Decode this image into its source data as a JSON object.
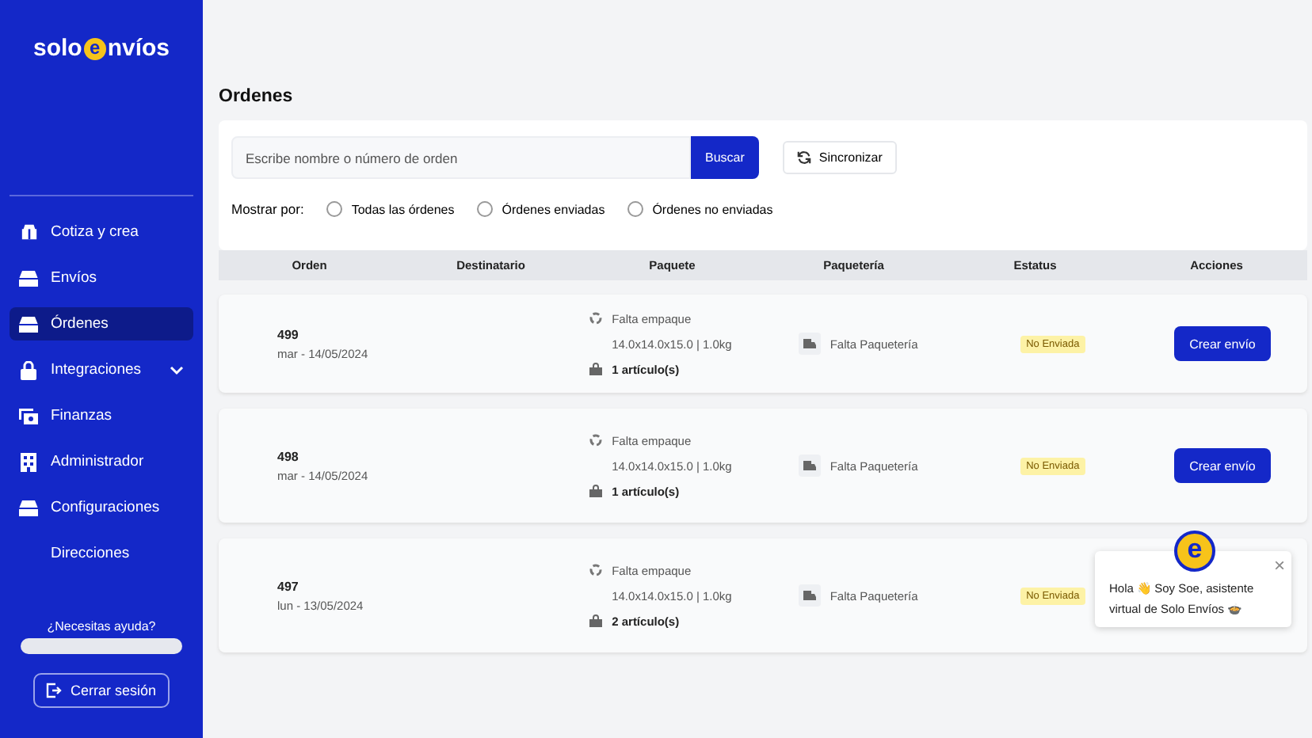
{
  "sidebar": {
    "logo": {
      "left": "solo",
      "mark": "e",
      "right": "nvíos"
    },
    "items": [
      {
        "label": "Cotiza y crea",
        "kind": "box",
        "selected": false
      },
      {
        "label": "Envíos",
        "kind": "tray",
        "selected": false
      },
      {
        "label": "Órdenes",
        "kind": "tray",
        "selected": true
      },
      {
        "label": "Integraciones",
        "kind": "lock",
        "selected": false,
        "expandable": true
      },
      {
        "label": "Finanzas",
        "kind": "cash",
        "selected": false
      },
      {
        "label": "Administrador",
        "kind": "building",
        "selected": false
      },
      {
        "label": "Configuraciones",
        "kind": "tray",
        "selected": false
      },
      {
        "label": "Direcciones",
        "selected": false
      }
    ],
    "help": "¿Necesitas ayuda?",
    "logout": "Cerrar sesión"
  },
  "page": {
    "title": "Ordenes",
    "search": {
      "placeholder": "Escribe nombre o número de orden",
      "button": "Buscar"
    },
    "sync": "Sincronizar",
    "filter": {
      "label": "Mostrar por:",
      "options": [
        {
          "label": "Todas las órdenes",
          "selected": false
        },
        {
          "label": "Órdenes enviadas",
          "selected": false
        },
        {
          "label": "Órdenes no enviadas",
          "selected": false
        }
      ]
    }
  },
  "table": {
    "columns": [
      "Orden",
      "Destinatario",
      "Paquete",
      "Paquetería",
      "Estatus",
      "Acciones"
    ],
    "rows": [
      {
        "order": "499",
        "date": "mar - 14/05/2024",
        "packaging": "Falta empaque",
        "dims": "14.0x14.0x15.0 | 1.0kg",
        "items": "1 artículo(s)",
        "carrier": "Falta Paquetería",
        "status": "No Enviada",
        "action": "Crear envío"
      },
      {
        "order": "498",
        "date": "mar - 14/05/2024",
        "packaging": "Falta empaque",
        "dims": "14.0x14.0x15.0 | 1.0kg",
        "items": "1 artículo(s)",
        "carrier": "Falta Paquetería",
        "status": "No Enviada",
        "action": "Crear envío"
      },
      {
        "order": "497",
        "date": "lun - 13/05/2024",
        "packaging": "Falta empaque",
        "dims": "14.0x14.0x15.0 | 1.0kg",
        "items": "2 artículo(s)",
        "carrier": "Falta Paquetería",
        "status": "No Enviada"
      }
    ]
  },
  "chat": {
    "avatar": "e",
    "message": "Hola 👋 Soy Soe, asistente virtual de Solo Envíos 🍲",
    "close": "×"
  }
}
